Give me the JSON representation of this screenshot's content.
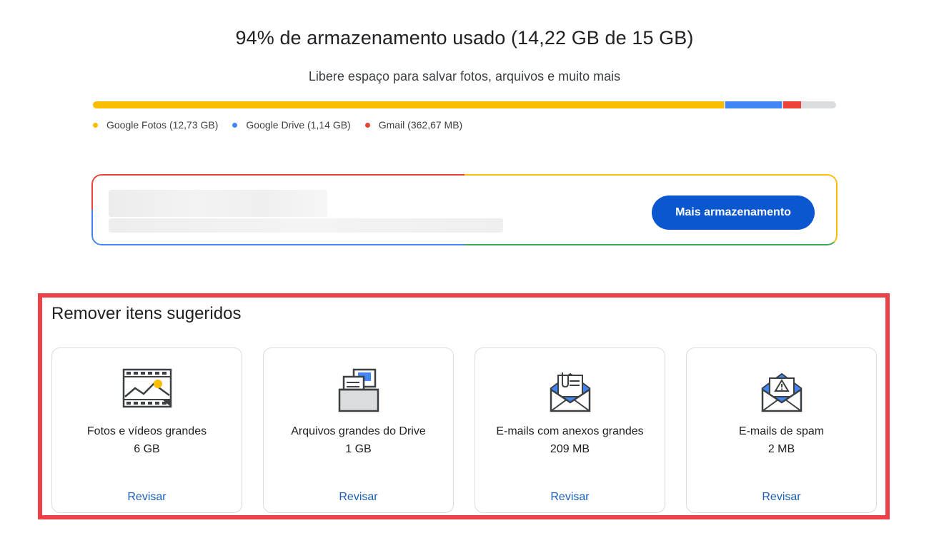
{
  "header": {
    "title": "94% de armazenamento usado (14,22 GB de 15 GB)",
    "subtitle": "Libere espaço para salvar fotos, arquivos e muito mais"
  },
  "usage": {
    "used_percent": 94,
    "segments": [
      {
        "name": "Google Fotos",
        "gb": 12.73,
        "color": "#fbbc04"
      },
      {
        "name": "Google Drive",
        "gb": 1.14,
        "color": "#4285f4"
      },
      {
        "name": "Gmail",
        "gb": 0.36267,
        "color": "#ea4335"
      }
    ],
    "total_gb": 15,
    "legend": [
      {
        "label": "Google Fotos (12,73 GB)",
        "color": "#fbbc04"
      },
      {
        "label": "Google Drive (1,14 GB)",
        "color": "#4285f4"
      },
      {
        "label": "Gmail (362,67 MB)",
        "color": "#ea4335"
      }
    ]
  },
  "promo": {
    "button_label": "Mais armazenamento"
  },
  "suggested": {
    "title": "Remover itens sugeridos",
    "cards": [
      {
        "icon": "photos-video-icon",
        "name": "Fotos e vídeos grandes",
        "size": "6 GB",
        "link": "Revisar"
      },
      {
        "icon": "drive-files-icon",
        "name": "Arquivos grandes do Drive",
        "size": "1 GB",
        "link": "Revisar"
      },
      {
        "icon": "email-attachment-icon",
        "name": "E-mails com anexos grandes",
        "size": "209 MB",
        "link": "Revisar"
      },
      {
        "icon": "spam-email-icon",
        "name": "E-mails de spam",
        "size": "2 MB",
        "link": "Revisar"
      }
    ]
  },
  "colors": {
    "accent": "#0b57d0",
    "link": "#1a5fb4",
    "highlight": "#ec4149"
  }
}
